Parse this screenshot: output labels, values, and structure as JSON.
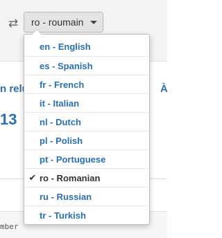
{
  "toolbar": {
    "language_button": "ro - roumain",
    "swap_icon": "swap-arrows-icon"
  },
  "background": {
    "left_fragment": "n relu",
    "right_fragment": "À",
    "number_fragment": "13",
    "code_fragment": "mber"
  },
  "dropdown": {
    "selected_code": "ro",
    "items": [
      {
        "label": "en - English"
      },
      {
        "label": "es - Spanish"
      },
      {
        "label": "fr - French"
      },
      {
        "label": "it - Italian"
      },
      {
        "label": "nl - Dutch"
      },
      {
        "label": "pl - Polish"
      },
      {
        "label": "pt - Portuguese"
      },
      {
        "label": "ro - Romanian"
      },
      {
        "label": "ru - Russian"
      },
      {
        "label": "tr - Turkish"
      }
    ]
  },
  "colors": {
    "link": "#2a6fb0",
    "selected_text": "#333333"
  }
}
